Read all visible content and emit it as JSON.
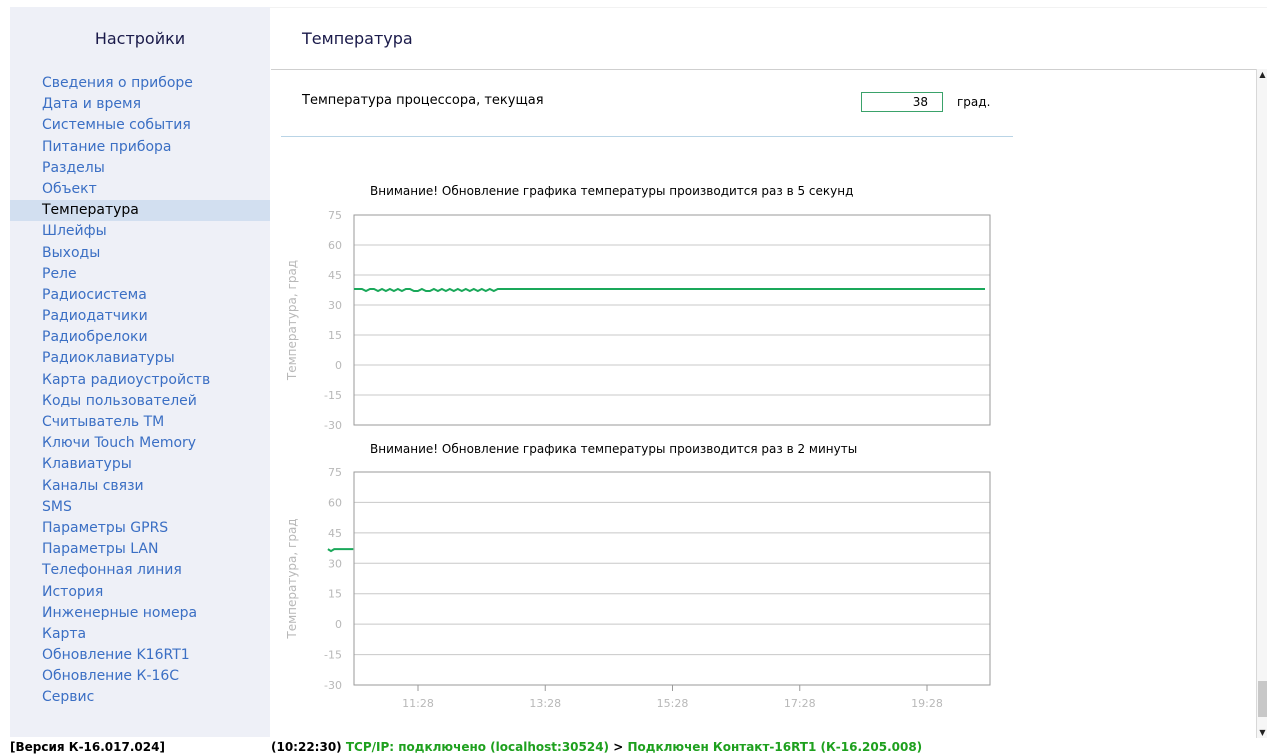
{
  "sidebar": {
    "title": "Настройки",
    "items": [
      {
        "label": "Сведения о приборе"
      },
      {
        "label": "Дата и время"
      },
      {
        "label": "Системные события"
      },
      {
        "label": "Питание прибора"
      },
      {
        "label": "Разделы"
      },
      {
        "label": "Объект"
      },
      {
        "label": "Температура",
        "active": true
      },
      {
        "label": "Шлейфы"
      },
      {
        "label": "Выходы"
      },
      {
        "label": "Реле"
      },
      {
        "label": "Радиосистема"
      },
      {
        "label": "Радиодатчики"
      },
      {
        "label": "Радиобрелоки"
      },
      {
        "label": "Радиоклавиатуры"
      },
      {
        "label": "Карта радиоустройств"
      },
      {
        "label": "Коды пользователей"
      },
      {
        "label": "Считыватель ТМ"
      },
      {
        "label": "Ключи Touch Memory"
      },
      {
        "label": "Клавиатуры"
      },
      {
        "label": "Каналы связи"
      },
      {
        "label": "SMS"
      },
      {
        "label": "Параметры GPRS"
      },
      {
        "label": "Параметры LAN"
      },
      {
        "label": "Телефонная линия"
      },
      {
        "label": "История"
      },
      {
        "label": "Инженерные номера"
      },
      {
        "label": "Карта"
      },
      {
        "label": "Обновление K16RT1"
      },
      {
        "label": "Обновление К-16С"
      },
      {
        "label": "Сервис"
      }
    ]
  },
  "main": {
    "title": "Температура",
    "cpu_temp_label": "Температура процессора, текущая",
    "cpu_temp_value": "38",
    "cpu_temp_unit": "град."
  },
  "colors": {
    "line": "#1aa85a",
    "grid": "#c8c8c8",
    "axis_text": "#b8b8b8",
    "link": "#3b6fc4",
    "status_green": "#1ea01e"
  },
  "chart_data": [
    {
      "type": "line",
      "title": "Внимание! Обновление графика температуры производится раз в 5 секунд",
      "ylabel": "Температура, град",
      "xlabel": "",
      "ylim": [
        -30,
        75
      ],
      "yticks": [
        "75",
        "60",
        "45",
        "30",
        "15",
        "0",
        "-15",
        "-30"
      ],
      "grid": true,
      "series": [
        {
          "x": [
            0,
            4,
            8,
            12,
            16,
            20,
            24,
            28,
            32,
            36,
            40,
            44,
            48,
            52,
            56,
            60,
            64,
            68,
            72,
            76,
            80,
            84,
            88,
            92,
            96,
            100,
            104,
            108,
            112,
            116,
            120,
            124,
            128,
            132,
            136,
            140,
            144,
            148,
            152,
            156,
            160,
            170,
            200,
            250,
            300,
            350,
            400,
            450,
            500,
            550,
            600,
            632
          ],
          "values": [
            38,
            38,
            38,
            37,
            38,
            38,
            37,
            38,
            37,
            38,
            37,
            38,
            37,
            38,
            38,
            37,
            37,
            38,
            37,
            37,
            38,
            37,
            38,
            37,
            38,
            37,
            38,
            37,
            38,
            37,
            38,
            37,
            38,
            37,
            38,
            37,
            38,
            38,
            38,
            38,
            38,
            38,
            38,
            38,
            38,
            38,
            38,
            38,
            38,
            38,
            38,
            38
          ]
        }
      ]
    },
    {
      "type": "line",
      "title": "Внимание! Обновление графика температуры производится раз в 2 минуты",
      "ylabel": "Температура, град",
      "xlabel": "",
      "ylim": [
        -30,
        75
      ],
      "yticks": [
        "75",
        "60",
        "45",
        "30",
        "15",
        "0",
        "-15",
        "-30"
      ],
      "xticks": [
        "11:28",
        "13:28",
        "15:28",
        "17:28",
        "19:28"
      ],
      "grid": true,
      "series": [
        {
          "x": [
            "10:03",
            "10:06",
            "10:09",
            "10:15",
            "10:21",
            "10:27"
          ],
          "values": [
            37,
            36,
            37,
            37,
            37,
            37
          ]
        }
      ]
    }
  ],
  "status": {
    "version": "[Версия К-16.017.024]",
    "time": "(10:22:30)",
    "connection": "TCP/IP: подключено (localhost:30524)",
    "separator": ">",
    "device": "Подключен Контакт-16RT1 (К-16.205.008)"
  }
}
